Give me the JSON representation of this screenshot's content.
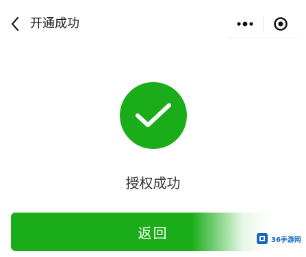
{
  "nav": {
    "title": "开通成功",
    "back_icon": "chevron-left-icon",
    "more_icon": "more-dots-icon",
    "close_icon": "target-close-icon"
  },
  "result": {
    "icon": "checkmark-icon",
    "message": "授权成功"
  },
  "actions": {
    "return_label": "返回"
  },
  "watermark": {
    "text": "36手游网"
  },
  "colors": {
    "accent": "#1aad19",
    "text": "#333333",
    "background": "#ffffff"
  }
}
